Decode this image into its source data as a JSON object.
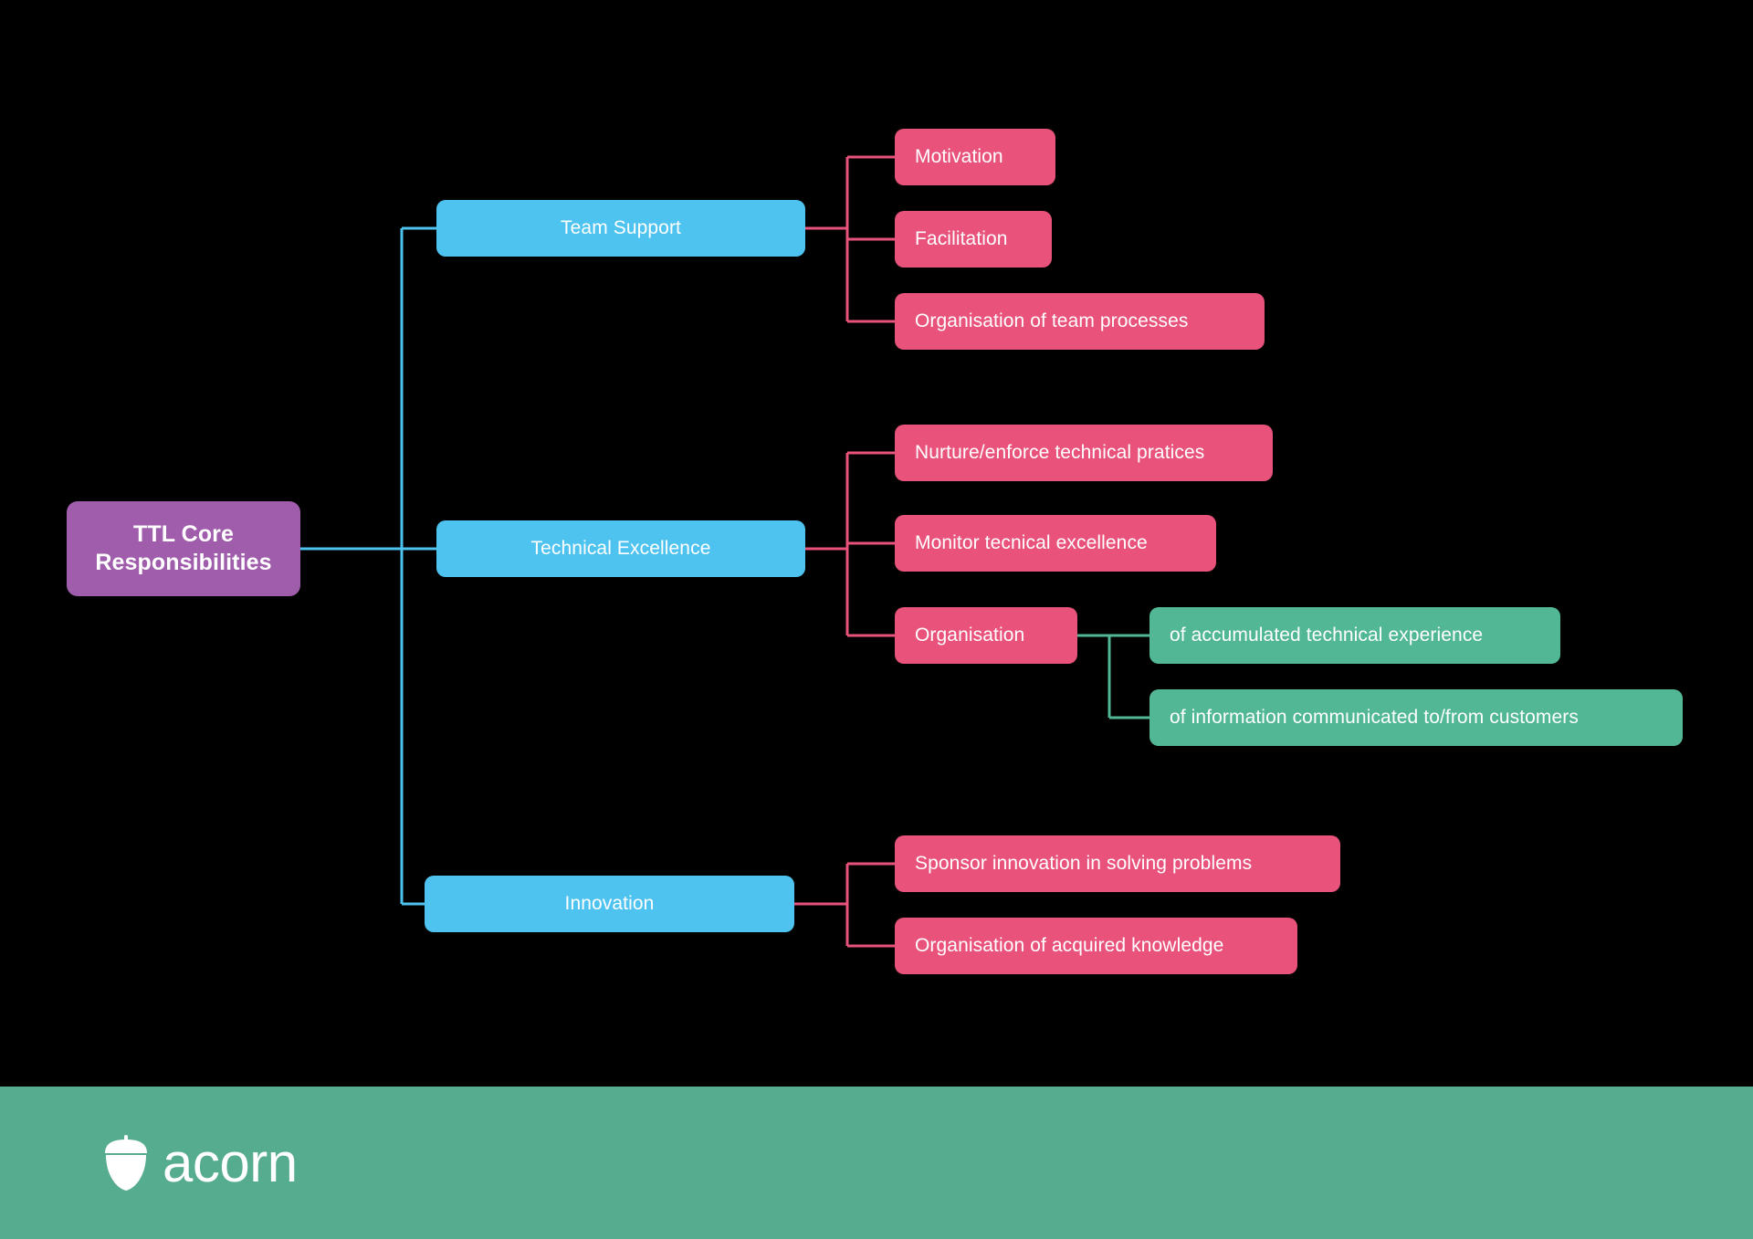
{
  "diagram": {
    "type": "mind-map",
    "background_color": "#000000",
    "root": {
      "label": "TTL Core\nResponsibilities",
      "label_line1": "TTL Core",
      "label_line2": "Responsibilities",
      "color": "#9f5dab"
    },
    "branch_color": "#4ec3ef",
    "leaf_color": "#e8527b",
    "subleaf_color": "#51b795",
    "branches": [
      {
        "label": "Team Support",
        "color": "#4ec3ef",
        "children": [
          {
            "label": "Motivation",
            "color": "#e8527b"
          },
          {
            "label": "Facilitation",
            "color": "#e8527b"
          },
          {
            "label": "Organisation of team processes",
            "color": "#e8527b"
          }
        ]
      },
      {
        "label": "Technical Excellence",
        "color": "#4ec3ef",
        "children": [
          {
            "label": "Nurture/enforce technical pratices",
            "color": "#e8527b"
          },
          {
            "label": "Monitor tecnical excellence",
            "color": "#e8527b"
          },
          {
            "label": "Organisation",
            "color": "#e8527b",
            "children": [
              {
                "label": "of accumulated technical experience",
                "color": "#51b795"
              },
              {
                "label": "of information communicated to/from customers",
                "color": "#51b795"
              }
            ]
          }
        ]
      },
      {
        "label": "Innovation",
        "color": "#4ec3ef",
        "children": [
          {
            "label": "Sponsor innovation in solving problems",
            "color": "#e8527b"
          },
          {
            "label": "Organisation of acquired knowledge",
            "color": "#e8527b"
          }
        ]
      }
    ]
  },
  "footer": {
    "background_color": "#55ac8e",
    "brand": "acorn",
    "logo_icon": "acorn-icon"
  }
}
